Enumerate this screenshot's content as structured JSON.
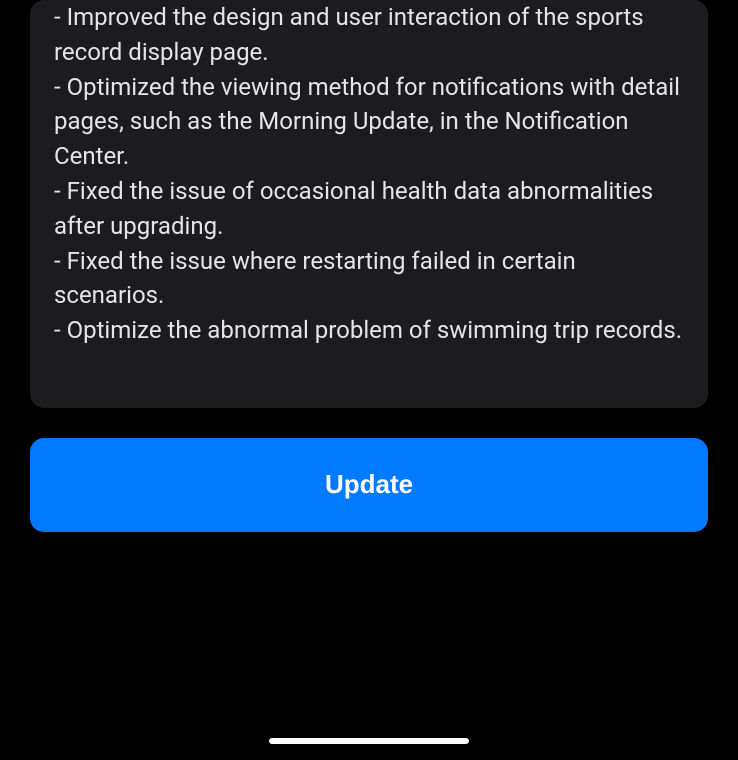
{
  "changelog": {
    "items": [
      "- Improved the design and user interaction of the sports record display page.",
      "- Optimized the viewing method for notifications with detail pages, such as the Morning Update, in the Notification Center.",
      "- Fixed the issue of occasional health data abnormalities after upgrading.",
      "- Fixed the issue where restarting failed in certain scenarios.",
      "- Optimize the abnormal problem of swimming trip records."
    ]
  },
  "actions": {
    "update_label": "Update"
  }
}
